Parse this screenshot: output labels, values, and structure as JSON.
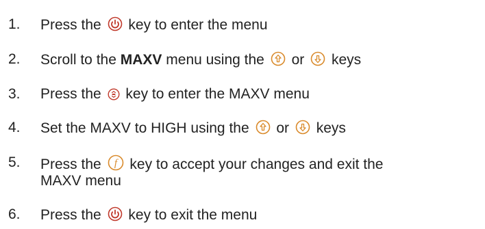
{
  "steps": [
    {
      "number": "1.",
      "parts": [
        "Press the",
        "key to enter the menu"
      ],
      "icons": [
        "power-key-icon"
      ]
    },
    {
      "number": "2.",
      "parts": [
        "Scroll to the",
        "MAXV",
        "menu using the",
        "or",
        "keys"
      ],
      "icons": [
        "up-key-icon",
        "down-key-icon"
      ]
    },
    {
      "number": "3.",
      "parts": [
        "Press the",
        "key to enter the MAXV menu"
      ],
      "icons": [
        "select-key-icon"
      ]
    },
    {
      "number": "4.",
      "parts": [
        "Set the MAXV to HIGH using the",
        "or",
        "keys"
      ],
      "icons": [
        "up-key-icon",
        "down-key-icon"
      ]
    },
    {
      "number": "5.",
      "parts": [
        "Press the",
        "key to accept your changes and exit the",
        "MAXV menu"
      ],
      "icons": [
        "function-key-icon"
      ]
    },
    {
      "number": "6.",
      "parts": [
        "Press the",
        "key to exit the menu"
      ],
      "icons": [
        "power-key-icon"
      ]
    }
  ],
  "icon_colors": {
    "power": "#c0392b",
    "arrows": "#d98a2b",
    "select": "#c0392b",
    "function": "#d98a2b"
  }
}
